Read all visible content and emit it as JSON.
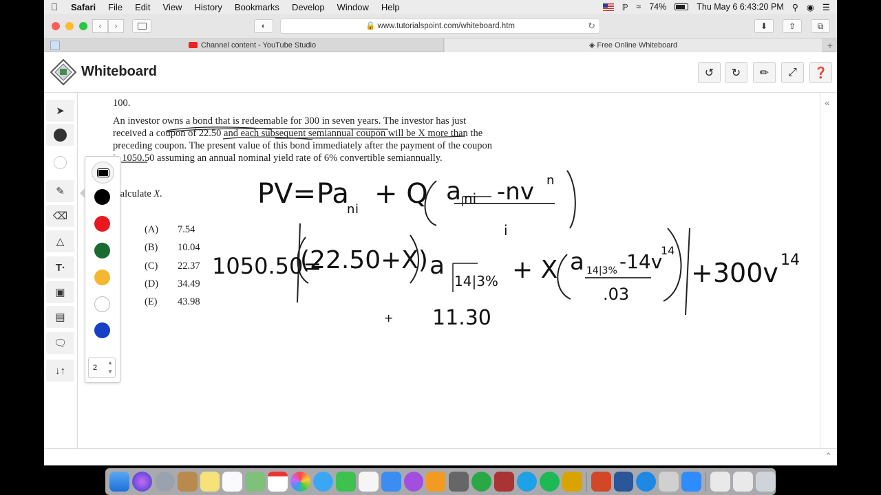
{
  "menubar": {
    "app": "Safari",
    "items": [
      "File",
      "Edit",
      "View",
      "History",
      "Bookmarks",
      "Develop",
      "Window",
      "Help"
    ],
    "battery": "74%",
    "datetime": "Thu May 6  6:43:20 PM"
  },
  "browser": {
    "url": "www.tutorialspoint.com/whiteboard.htm",
    "tabs": [
      {
        "title": "Channel content - YouTube Studio"
      },
      {
        "title": "Free Online Whiteboard"
      }
    ]
  },
  "app": {
    "title": "Whiteboard"
  },
  "palette": {
    "colors": [
      "#000000",
      "#e8191e",
      "#1a6b30",
      "#f5b730",
      "#ffffff",
      "#1740c7"
    ],
    "stroke_size": "2"
  },
  "document": {
    "problem_number": "100.",
    "paragraph": [
      "An investor owns a bond that is redeemable for 300 in seven years.  The investor has just",
      "received a coupon of 22.50 and each subsequent semiannual coupon will be X more than the",
      "preceding coupon.  The present value of this bond immediately after the payment of the coupon",
      "is 1050.50 assuming an annual nominal yield rate of 6% convertible semiannually."
    ],
    "prompt_prefix": "Calculate ",
    "prompt_var": "X.",
    "choices": [
      {
        "letter": "(A)",
        "value": "7.54"
      },
      {
        "letter": "(B)",
        "value": "10.04"
      },
      {
        "letter": "(C)",
        "value": "22.37"
      },
      {
        "letter": "(D)",
        "value": "34.49"
      },
      {
        "letter": "(E)",
        "value": "43.98"
      }
    ]
  },
  "handwriting": {
    "formula_pv": "PV=",
    "formula_pa": "Pa",
    "formula_sub_n": "n",
    "formula_sub_i": "i",
    "formula_plus_q": "+ Q",
    "formula_a": "a",
    "formula_sub_ni": "ni",
    "formula_minus_nv": "-nv",
    "formula_exp_n": "n",
    "formula_den_i": "i",
    "eq_lhs": "1050.50=",
    "eq_paren": "(22.50+X)",
    "eq_a": "a",
    "eq_sub": "14|3%",
    "eq_plus_x": "+ X",
    "eq_a2": "a",
    "eq_sub2": "14|3%",
    "eq_minus14v": "-14v",
    "eq_exp14": "14",
    "eq_den": ".03",
    "eq_plus300": "+300v",
    "eq_exp14b": "14",
    "note": "11.30",
    "cursor": "+"
  }
}
